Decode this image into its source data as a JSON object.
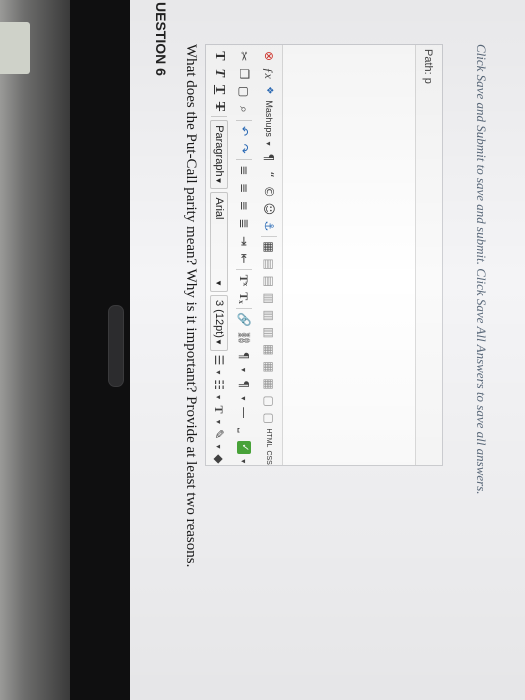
{
  "question": {
    "heading": "UESTION 6",
    "text": "What does the Put-Call parity mean? Why is it important? Provide at least two reasons."
  },
  "toolbar": {
    "row1": {
      "bold": "T",
      "italic": "T",
      "underline": "T",
      "strike": "T",
      "paragraph": "Paragraph",
      "font": "Arial",
      "size": "3 (12pt)"
    },
    "row3": {
      "mashups": "Mashups",
      "html": "HTML",
      "css": "CSS"
    }
  },
  "editor": {
    "path_label": "Path: p"
  },
  "footer": {
    "note": "Click Save and Submit to save and submit. Click Save All Answers to save all answers."
  }
}
